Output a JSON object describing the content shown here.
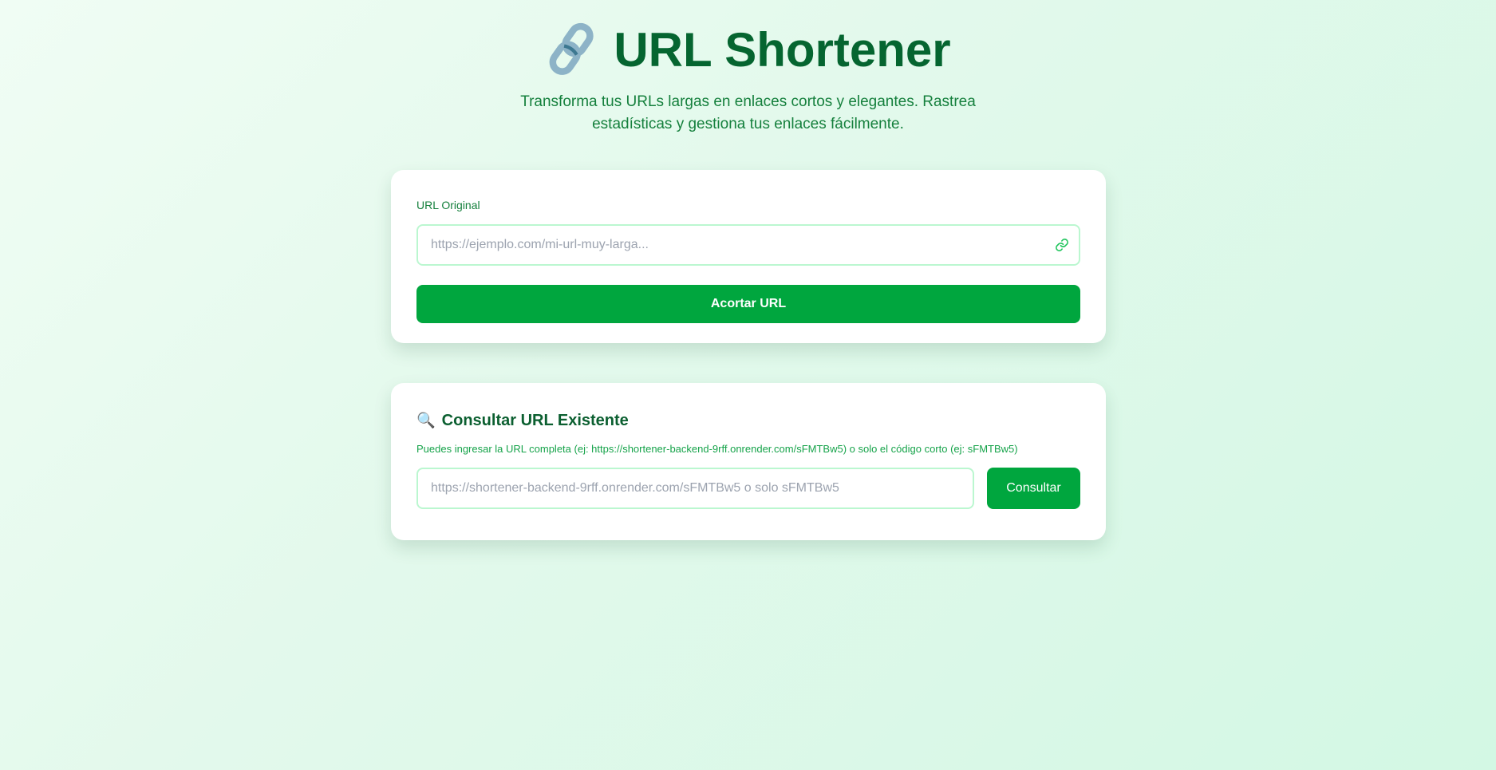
{
  "header": {
    "icon": "link-emoji-icon",
    "title": "URL Shortener",
    "subtitle": "Transforma tus URLs largas en enlaces cortos y elegantes. Rastrea estadísticas y gestiona tus enlaces fácilmente."
  },
  "shorten_card": {
    "label": "URL Original",
    "input_placeholder": "https://ejemplo.com/mi-url-muy-larga...",
    "input_value": "",
    "button_label": "Acortar URL"
  },
  "lookup_card": {
    "heading": "Consultar URL Existente",
    "help": "Puedes ingresar la URL completa (ej: https://shortener-backend-9rff.onrender.com/sFMTBw5) o solo el código corto (ej: sFMTBw5)",
    "input_placeholder": "https://shortener-backend-9rff.onrender.com/sFMTBw5 o solo sFMTBw5",
    "input_value": "",
    "button_label": "Consultar"
  },
  "colors": {
    "primary": "#00a63e",
    "title": "#056530",
    "accent": "#15803d"
  }
}
